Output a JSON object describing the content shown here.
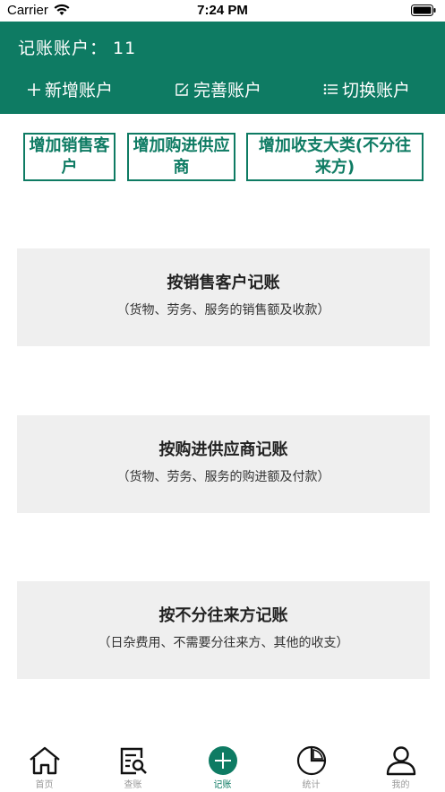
{
  "status_bar": {
    "carrier": "Carrier",
    "time": "7:24 PM"
  },
  "header": {
    "account_label": "记账账户：",
    "account_value": "11",
    "actions": [
      {
        "label": "新增账户",
        "icon": "plus-icon"
      },
      {
        "label": "完善账户",
        "icon": "edit-icon"
      },
      {
        "label": "切换账户",
        "icon": "list-icon"
      }
    ]
  },
  "quick_buttons": [
    {
      "label": "增加销售客户"
    },
    {
      "label": "增加购进供应商"
    },
    {
      "label": "增加收支大类(不分往来方)"
    }
  ],
  "cards": [
    {
      "title": "按销售客户记账",
      "subtitle": "（货物、劳务、服务的销售额及收款）"
    },
    {
      "title": "按购进供应商记账",
      "subtitle": "（货物、劳务、服务的购进额及付款）"
    },
    {
      "title": "按不分往来方记账",
      "subtitle": "（日杂费用、不需要分往来方、其他的收支）"
    }
  ],
  "tabs": [
    {
      "label": "首页",
      "icon": "home-icon"
    },
    {
      "label": "查账",
      "icon": "ledger-search-icon"
    },
    {
      "label": "记账",
      "icon": "add-circle-icon",
      "active": true
    },
    {
      "label": "统计",
      "icon": "pie-chart-icon"
    },
    {
      "label": "我的",
      "icon": "user-icon"
    }
  ],
  "colors": {
    "primary": "#0e7b63",
    "card_bg": "#efefef",
    "tab_inactive": "#999999"
  }
}
